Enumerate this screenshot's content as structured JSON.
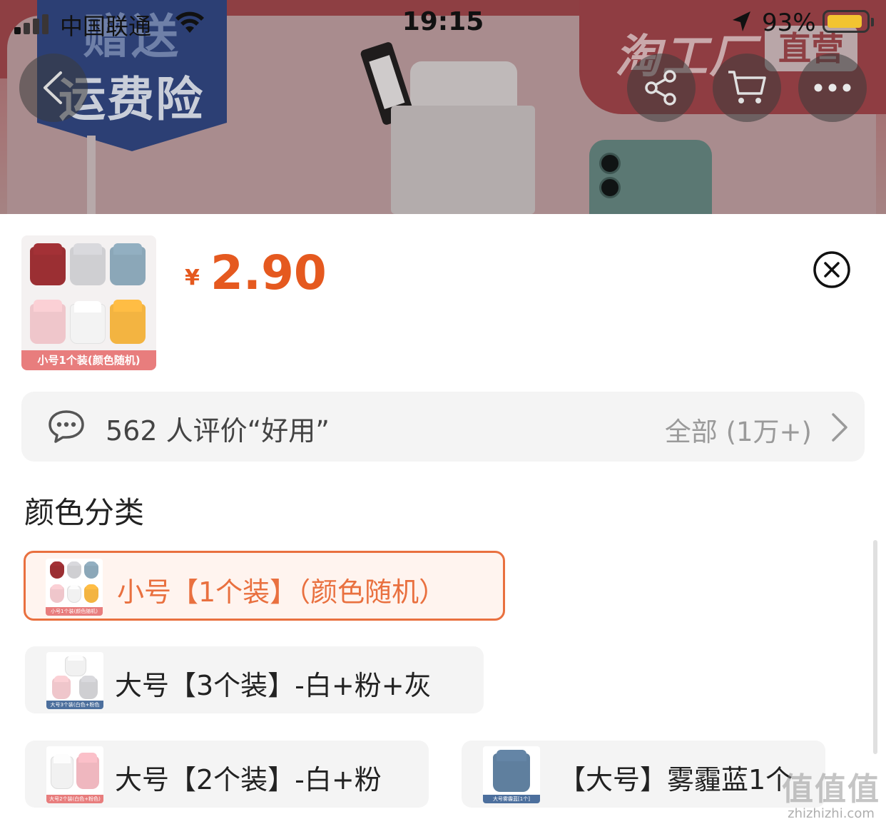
{
  "status_bar": {
    "carrier": "中国联通",
    "time": "19:15",
    "battery_percent": "93%",
    "battery_level": 0.93,
    "icons": [
      "signal-icon",
      "wifi-icon",
      "location-icon",
      "battery-icon"
    ]
  },
  "hero": {
    "badge_line1": "赠送",
    "badge_line2": "运费险",
    "brand": "淘工厂",
    "brand_tag": "直营"
  },
  "nav": {
    "back_icon": "chevron-left-icon",
    "share_icon": "share-icon",
    "cart_icon": "cart-icon",
    "more_icon": "more-icon"
  },
  "product": {
    "thumb_caption": "小号1个装(颜色随机)",
    "currency": "¥",
    "price": "2.90"
  },
  "review": {
    "text": "562 人评价“好用”",
    "all_label": "全部 (1万+)"
  },
  "variants": {
    "title": "颜色分类",
    "options": [
      {
        "label": "小号【1个装】（颜色随机）",
        "thumb_caption": "小号1个装(颜色随机)",
        "selected": true
      },
      {
        "label": "大号【3个装】-白+粉+灰",
        "thumb_caption": "大号3个装(白色+粉色+灰色)",
        "selected": false
      },
      {
        "label": "大号【2个装】-白+粉",
        "thumb_caption": "大号2个装(白色+粉色)",
        "selected": false
      },
      {
        "label": "【大号】雾霾蓝1个",
        "thumb_caption": "大号雾霾蓝[1个]",
        "selected": false
      }
    ]
  },
  "watermark": {
    "mark": "值值值",
    "url": "zhizhizhi.com"
  },
  "colors": {
    "accent": "#e9703f",
    "price": "#e5591f",
    "caption_pink": "#e87d7d"
  }
}
